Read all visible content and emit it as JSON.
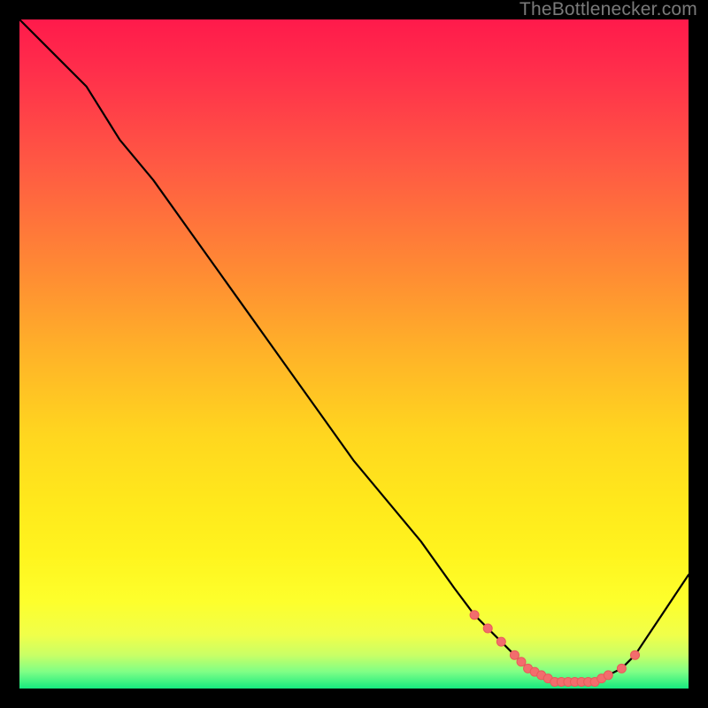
{
  "watermark": "TheBottlenecker.com",
  "chart_data": {
    "type": "line",
    "title": "",
    "xlabel": "",
    "ylabel": "",
    "xlim": [
      0,
      100
    ],
    "ylim": [
      0,
      100
    ],
    "grid": false,
    "legend": false,
    "background_gradient_stops": [
      {
        "pct": 0,
        "color": "#ff1a4b"
      },
      {
        "pct": 8,
        "color": "#ff2f4b"
      },
      {
        "pct": 22,
        "color": "#ff5a43"
      },
      {
        "pct": 38,
        "color": "#ff8c33"
      },
      {
        "pct": 50,
        "color": "#ffb328"
      },
      {
        "pct": 62,
        "color": "#ffd61f"
      },
      {
        "pct": 72,
        "color": "#ffe81c"
      },
      {
        "pct": 80,
        "color": "#fff41e"
      },
      {
        "pct": 87,
        "color": "#fdff2c"
      },
      {
        "pct": 92,
        "color": "#f0ff4a"
      },
      {
        "pct": 95,
        "color": "#c9ff66"
      },
      {
        "pct": 97.5,
        "color": "#7fff86"
      },
      {
        "pct": 100,
        "color": "#16e97f"
      }
    ],
    "series": [
      {
        "name": "bottleneck-curve",
        "stroke": "#000000",
        "stroke_width": 2.2,
        "x": [
          0,
          5,
          10,
          15,
          20,
          25,
          30,
          35,
          40,
          45,
          50,
          55,
          60,
          65,
          68,
          70,
          72,
          74,
          76,
          78,
          80,
          82,
          84,
          86,
          88,
          90,
          92,
          94,
          96,
          98,
          100
        ],
        "y": [
          100,
          95,
          90,
          82,
          76,
          69,
          62,
          55,
          48,
          41,
          34,
          28,
          22,
          15,
          11,
          9,
          7,
          5,
          3,
          2,
          1,
          1,
          1,
          1,
          2,
          3,
          5,
          8,
          11,
          14,
          17
        ]
      }
    ],
    "highlight_points": {
      "name": "valley-markers",
      "fill": "#f26d6d",
      "stroke": "#e85a5a",
      "radius": 5,
      "x": [
        68,
        70,
        72,
        74,
        75,
        76,
        77,
        78,
        79,
        80,
        81,
        82,
        83,
        84,
        85,
        86,
        87,
        88,
        90,
        92
      ],
      "y": [
        11,
        9,
        7,
        5,
        4,
        3,
        2.5,
        2,
        1.5,
        1,
        1,
        1,
        1,
        1,
        1,
        1,
        1.5,
        2,
        3,
        5
      ]
    }
  }
}
